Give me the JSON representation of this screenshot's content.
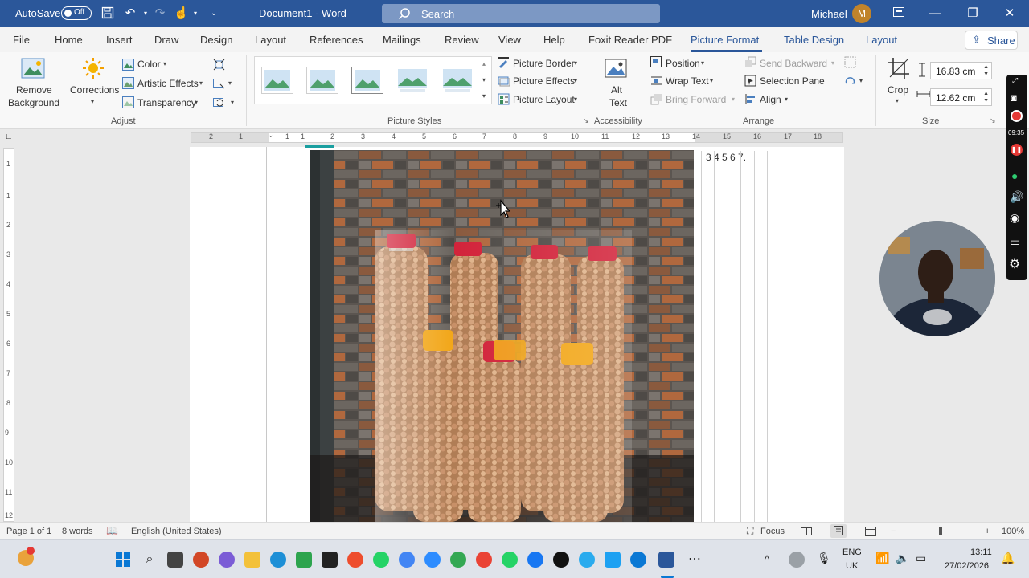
{
  "titlebar": {
    "autosave": "AutoSave",
    "toggle": "Off",
    "doc_title": "Document1  -  Word",
    "search_placeholder": "Search",
    "user": "Michael",
    "avatar_initial": "M"
  },
  "tabs": [
    "File",
    "Home",
    "Insert",
    "Draw",
    "Design",
    "Layout",
    "References",
    "Mailings",
    "Review",
    "View",
    "Help",
    "Foxit Reader PDF",
    "Picture Format",
    "Table Design",
    "Layout"
  ],
  "share": "Share",
  "ribbon": {
    "remove_bg_1": "Remove",
    "remove_bg_2": "Background",
    "corrections": "Corrections",
    "color": "Color",
    "artistic": "Artistic Effects",
    "transparency": "Transparency",
    "adjust_label": "Adjust",
    "picture_styles_label": "Picture Styles",
    "picture_border": "Picture Border",
    "picture_effects": "Picture Effects",
    "picture_layout": "Picture Layout",
    "alt_text_1": "Alt",
    "alt_text_2": "Text",
    "accessibility_label": "Accessibility",
    "position": "Position",
    "wrap_text": "Wrap Text",
    "bring_forward": "Bring Forward",
    "send_backward": "Send Backward",
    "selection_pane": "Selection Pane",
    "align": "Align",
    "arrange_label": "Arrange",
    "crop": "Crop",
    "height": "16.83 cm",
    "width": "12.62 cm",
    "size_label": "Size"
  },
  "ruler": {
    "h_numbers": [
      "2",
      "1",
      "1",
      "1",
      "2",
      "3",
      "4",
      "5",
      "6",
      "7",
      "8",
      "9",
      "10",
      "11",
      "12",
      "13",
      "14",
      "15",
      "16",
      "17",
      "18"
    ],
    "v_numbers": [
      "1",
      "1",
      "2",
      "3",
      "4",
      "5",
      "6",
      "7",
      "8",
      "9",
      "10",
      "11",
      "12"
    ]
  },
  "document": {
    "column_numbers": "3  4  5  6  7."
  },
  "recorder": {
    "time": "09:35"
  },
  "status": {
    "page": "Page 1 of 1",
    "words": "8 words",
    "language": "English (United States)",
    "focus": "Focus",
    "zoom": "100%"
  },
  "tray": {
    "lang1": "ENG",
    "lang2": "UK",
    "time": "13:11",
    "date": "27/02/2026"
  }
}
